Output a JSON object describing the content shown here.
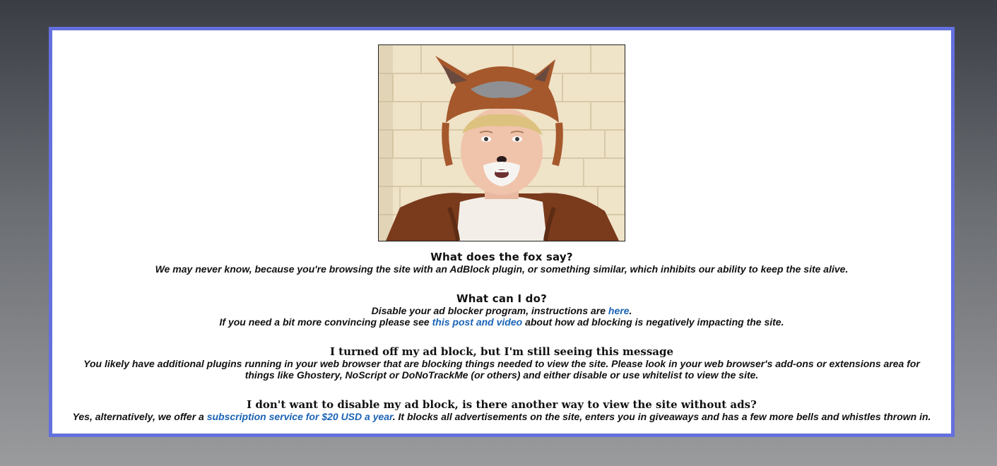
{
  "photo": {
    "subject": "person-in-fox-costume-photo"
  },
  "sections": [
    {
      "heading": "What does the fox say?",
      "body": "We may never know, because you're browsing the site with an AdBlock plugin, or something similar, which inhibits our ability to keep the site alive."
    },
    {
      "heading": "What can I do?",
      "line1_pre": "Disable your ad blocker program, instructions are ",
      "line1_link": "here",
      "line1_post": ".",
      "line2_pre": "If you need a bit more convincing please see ",
      "line2_link": "this post and video",
      "line2_post": " about how ad blocking is negatively impacting the site."
    },
    {
      "heading": "I turned off my ad block, but I'm still seeing this message",
      "body": "You likely have additional plugins running in your web browser that are blocking things needed to view the site. Please look in your web browser's add-ons or extensions area for things like Ghostery, NoScript or DoNoTrackMe (or others) and either disable or use whitelist to view the site."
    },
    {
      "heading": "I don't want to disable my ad block, is there another way to view the site without ads?",
      "pre": "Yes, alternatively, we offer a ",
      "link": "subscription service for $20 USD a year",
      "post": ". It blocks all advertisements on the site, enters you in giveaways and has a few more bells and whistles thrown in."
    }
  ],
  "colors": {
    "border": "#6470dd",
    "link": "#1a63b5",
    "background_top": "#3a3d44",
    "background_bottom": "#9a9b9d"
  }
}
